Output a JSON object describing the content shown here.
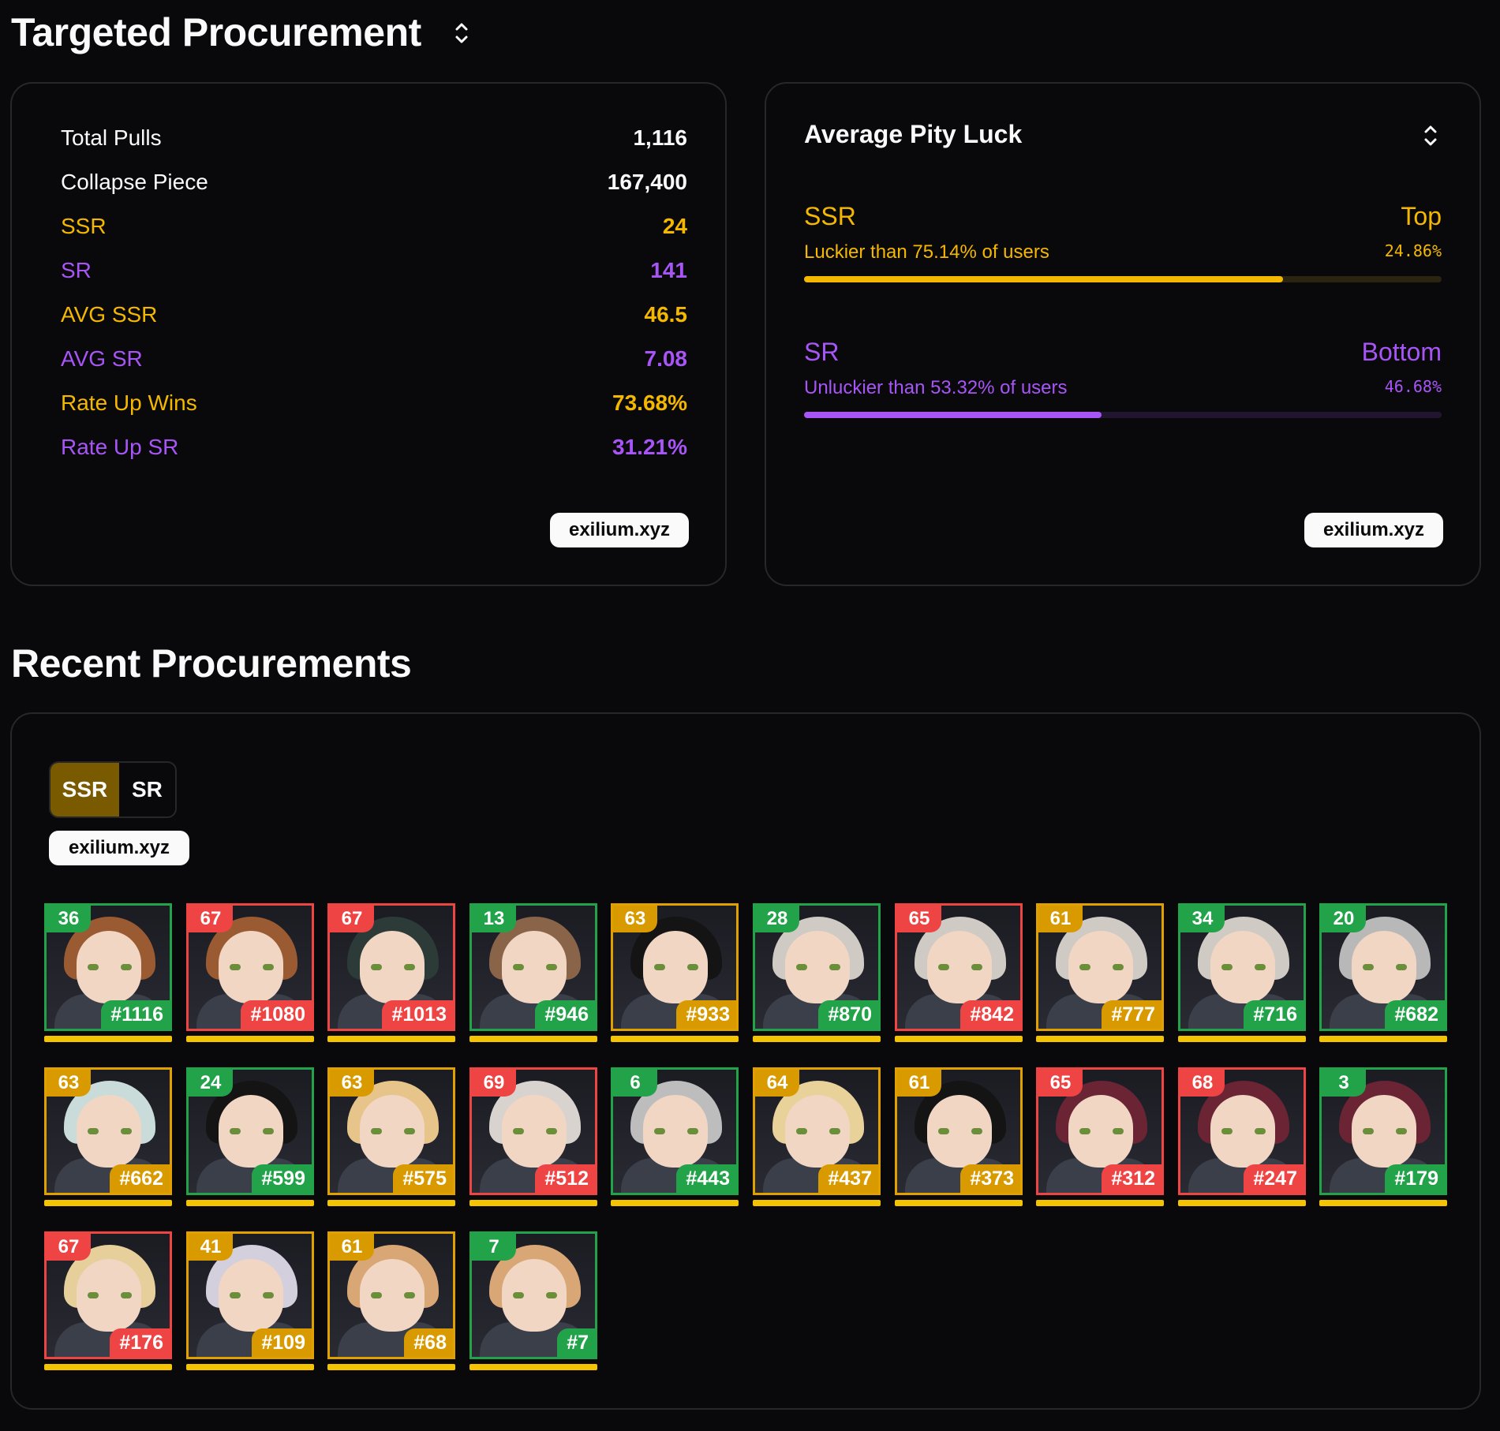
{
  "header": {
    "title": "Targeted Procurement"
  },
  "stats": {
    "rows": [
      {
        "label": "Total Pulls",
        "value": "1,116",
        "color": "#fafafa"
      },
      {
        "label": "Collapse Piece",
        "value": "167,400",
        "color": "#fafafa"
      },
      {
        "label": "SSR",
        "value": "24",
        "color": "#f5b800"
      },
      {
        "label": "SR",
        "value": "141",
        "color": "#a855f7"
      },
      {
        "label": "AVG SSR",
        "value": "46.5",
        "color": "#f5b800"
      },
      {
        "label": "AVG SR",
        "value": "7.08",
        "color": "#a855f7"
      },
      {
        "label": "Rate Up Wins",
        "value": "73.68%",
        "color": "#f5b800"
      },
      {
        "label": "Rate Up SR",
        "value": "31.21%",
        "color": "#a855f7"
      }
    ],
    "watermark": "exilium.xyz"
  },
  "luck": {
    "title": "Average Pity Luck",
    "ssr": {
      "label": "SSR",
      "side": "Top",
      "desc": "Luckier than 75.14% of users",
      "pct": "24.86%",
      "fill": 0.7514,
      "color": "#f5b800"
    },
    "sr": {
      "label": "SR",
      "side": "Bottom",
      "desc": "Unluckier than 53.32% of users",
      "pct": "46.68%",
      "fill": 0.4668,
      "color": "#a855f7"
    },
    "watermark": "exilium.xyz"
  },
  "recent": {
    "title": "Recent Procurements",
    "toggle": {
      "ssr": "SSR",
      "sr": "SR"
    },
    "watermark": "exilium.xyz",
    "pulls": [
      {
        "pity": "36",
        "num": "#1116",
        "status": "green",
        "hair": "#9a5a32"
      },
      {
        "pity": "67",
        "num": "#1080",
        "status": "red",
        "hair": "#9a5a32"
      },
      {
        "pity": "67",
        "num": "#1013",
        "status": "red",
        "hair": "#2c3b38"
      },
      {
        "pity": "13",
        "num": "#946",
        "status": "green",
        "hair": "#8a6448"
      },
      {
        "pity": "63",
        "num": "#933",
        "status": "gold",
        "hair": "#141414"
      },
      {
        "pity": "28",
        "num": "#870",
        "status": "green",
        "hair": "#cfcac3"
      },
      {
        "pity": "65",
        "num": "#842",
        "status": "red",
        "hair": "#cfcac3"
      },
      {
        "pity": "61",
        "num": "#777",
        "status": "gold",
        "hair": "#cfcac3"
      },
      {
        "pity": "34",
        "num": "#716",
        "status": "green",
        "hair": "#cfcac3"
      },
      {
        "pity": "20",
        "num": "#682",
        "status": "green",
        "hair": "#b8b8b8"
      },
      {
        "pity": "63",
        "num": "#662",
        "status": "gold",
        "hair": "#c9dcd9"
      },
      {
        "pity": "24",
        "num": "#599",
        "status": "green",
        "hair": "#141414"
      },
      {
        "pity": "63",
        "num": "#575",
        "status": "gold",
        "hair": "#e6c48a"
      },
      {
        "pity": "69",
        "num": "#512",
        "status": "red",
        "hair": "#d9d3cf"
      },
      {
        "pity": "6",
        "num": "#443",
        "status": "green",
        "hair": "#bdbdbd"
      },
      {
        "pity": "64",
        "num": "#437",
        "status": "gold",
        "hair": "#e8d29a"
      },
      {
        "pity": "61",
        "num": "#373",
        "status": "gold",
        "hair": "#141414"
      },
      {
        "pity": "65",
        "num": "#312",
        "status": "red",
        "hair": "#6a2434"
      },
      {
        "pity": "68",
        "num": "#247",
        "status": "red",
        "hair": "#6a2434"
      },
      {
        "pity": "3",
        "num": "#179",
        "status": "green",
        "hair": "#6a2434"
      },
      {
        "pity": "67",
        "num": "#176",
        "status": "red",
        "hair": "#e6cf9a"
      },
      {
        "pity": "41",
        "num": "#109",
        "status": "gold",
        "hair": "#d3cfdc"
      },
      {
        "pity": "61",
        "num": "#68",
        "status": "gold",
        "hair": "#d9a776"
      },
      {
        "pity": "7",
        "num": "#7",
        "status": "green",
        "hair": "#d9a776"
      }
    ]
  }
}
